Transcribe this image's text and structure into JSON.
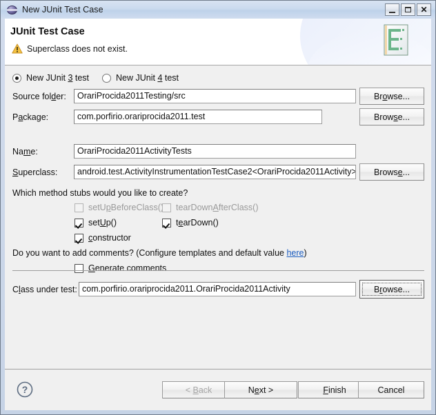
{
  "window": {
    "title": "New JUnit Test Case",
    "title_icon": "junit-sphere-icon",
    "controls": {
      "minimize": "minimize-icon",
      "maximize": "maximize-icon",
      "close": "close-icon"
    }
  },
  "banner": {
    "title": "JUnit Test Case",
    "message": "Superclass does not exist.",
    "message_icon": "warning-icon",
    "wizard_icon": "junit-testcase-banner-icon",
    "warning_color": "#f0b323"
  },
  "version_choice": {
    "junit3": {
      "label_pre": "New JUnit ",
      "mnemonic": "3",
      "label_post": " test",
      "selected": true
    },
    "junit4": {
      "label_pre": "New JUnit ",
      "mnemonic": "4",
      "label_post": " test",
      "selected": false
    }
  },
  "fields": {
    "source_folder": {
      "label_pre": "Source fol",
      "mnemonic": "d",
      "label_post": "er:",
      "value": "OrariProcida2011Testing/src",
      "browse": {
        "label_pre": "Br",
        "mnemonic": "o",
        "label_post": "wse..."
      }
    },
    "package": {
      "label_pre": "P",
      "mnemonic": "a",
      "label_post": "ckage:",
      "value": "com.porfirio.orariprocida2011.test",
      "browse": {
        "label_pre": "Brow",
        "mnemonic": "s",
        "label_post": "e..."
      }
    },
    "name": {
      "label_pre": "Na",
      "mnemonic": "m",
      "label_post": "e:",
      "value": "OrariProcida2011ActivityTests"
    },
    "superclass": {
      "label_pre": "",
      "mnemonic": "S",
      "label_post": "uperclass:",
      "value": "android.test.ActivityInstrumentationTestCase2<OrariProcida2011Activity>",
      "browse": {
        "label_pre": "Brows",
        "mnemonic": "e",
        "label_post": "..."
      }
    },
    "class_under_test": {
      "label_pre": "C",
      "mnemonic": "l",
      "label_post": "ass under test:",
      "value": "com.porfirio.orariprocida2011.OrariProcida2011Activity",
      "browse": {
        "label_pre": "B",
        "mnemonic": "r",
        "label_post": "owse..."
      }
    }
  },
  "stubs": {
    "question": "Which method stubs would you like to create?",
    "items": [
      {
        "label_pre": "setU",
        "mnemonic": "p",
        "label_post": "BeforeClass()",
        "checked": false,
        "enabled": false
      },
      {
        "label_pre": "tearDown",
        "mnemonic": "A",
        "label_post": "fterClass()",
        "checked": false,
        "enabled": false
      },
      {
        "label_pre": "set",
        "mnemonic": "U",
        "label_post": "p()",
        "checked": true,
        "enabled": true
      },
      {
        "label_pre": "t",
        "mnemonic": "e",
        "label_post": "arDown()",
        "checked": true,
        "enabled": true
      },
      {
        "label_pre": "",
        "mnemonic": "c",
        "label_post": "onstructor",
        "checked": true,
        "enabled": true
      }
    ]
  },
  "comments": {
    "question_pre": "Do you want to add comments? (Configure templates and default value ",
    "link": "here",
    "question_post": ")",
    "generate": {
      "label_pre": "",
      "mnemonic": "G",
      "label_post": "enerate comments",
      "checked": false
    }
  },
  "buttonbar": {
    "help_icon": "help-question-icon",
    "buttons": [
      {
        "name": "back-button",
        "label_pre": "< ",
        "mnemonic": "B",
        "label_post": "ack",
        "enabled": false
      },
      {
        "name": "next-button",
        "label_pre": "N",
        "mnemonic": "e",
        "label_post": "xt >",
        "enabled": true
      },
      {
        "name": "finish-button",
        "label_pre": "",
        "mnemonic": "F",
        "label_post": "inish",
        "enabled": true
      },
      {
        "name": "cancel-button",
        "label_pre": "Cancel",
        "mnemonic": "",
        "label_post": "",
        "enabled": true
      }
    ]
  }
}
